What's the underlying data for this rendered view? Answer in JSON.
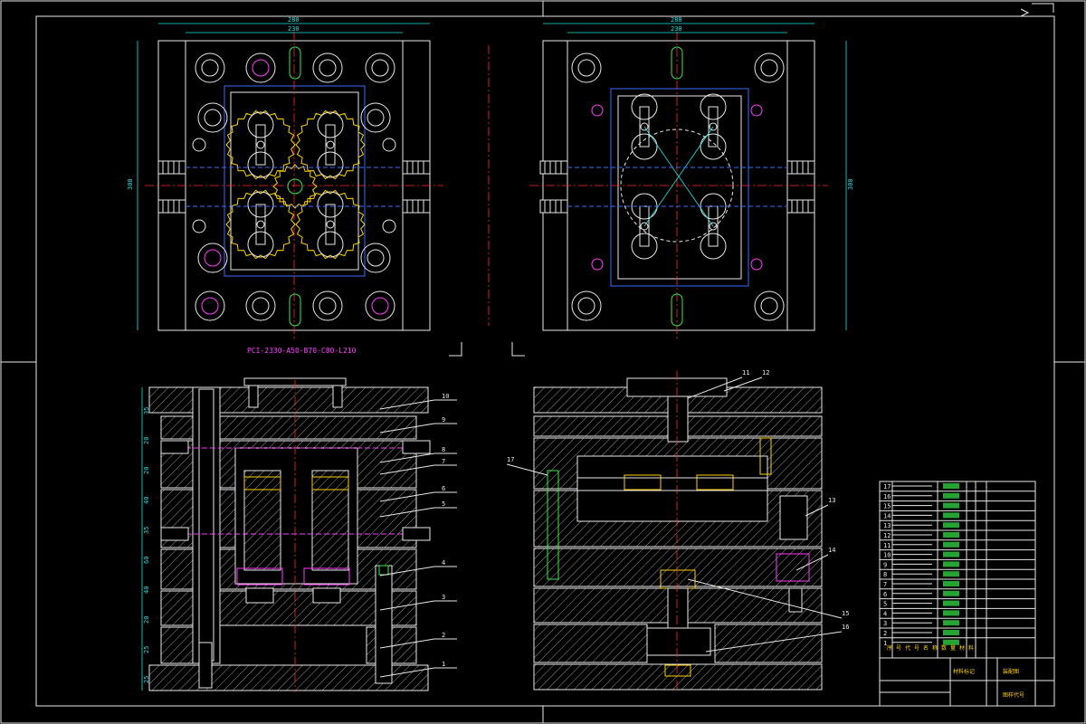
{
  "drawing": {
    "designation": "PCI-2330-A50-B70-C80-L210",
    "top_views": {
      "left": {
        "width_outer": "280",
        "width_inner": "230",
        "height": "300"
      },
      "right": {
        "width_outer": "280",
        "width_inner": "230",
        "height": "300"
      }
    },
    "left_section": {
      "balloons": [
        "1",
        "2",
        "3",
        "4",
        "5",
        "6",
        "7",
        "8",
        "9",
        "10"
      ],
      "stack_dims": [
        "25",
        "25",
        "20",
        "40",
        "60",
        "35",
        "40",
        "20",
        "20",
        "35"
      ]
    },
    "right_section": {
      "balloons": [
        "11",
        "12",
        "13",
        "14",
        "15",
        "16",
        "17"
      ]
    },
    "title_block": {
      "rows": [
        "17",
        "16",
        "15",
        "14",
        "13",
        "12",
        "11",
        "10",
        "9",
        "8",
        "7",
        "6",
        "5",
        "4",
        "3",
        "2",
        "1"
      ],
      "headers": [
        "序",
        "号",
        "代",
        "号",
        "名",
        "称",
        "数",
        "量",
        "材",
        "料"
      ],
      "material_caption": "材料标记",
      "drawing_name": "装配图",
      "drawing_code": "图样代号"
    }
  }
}
